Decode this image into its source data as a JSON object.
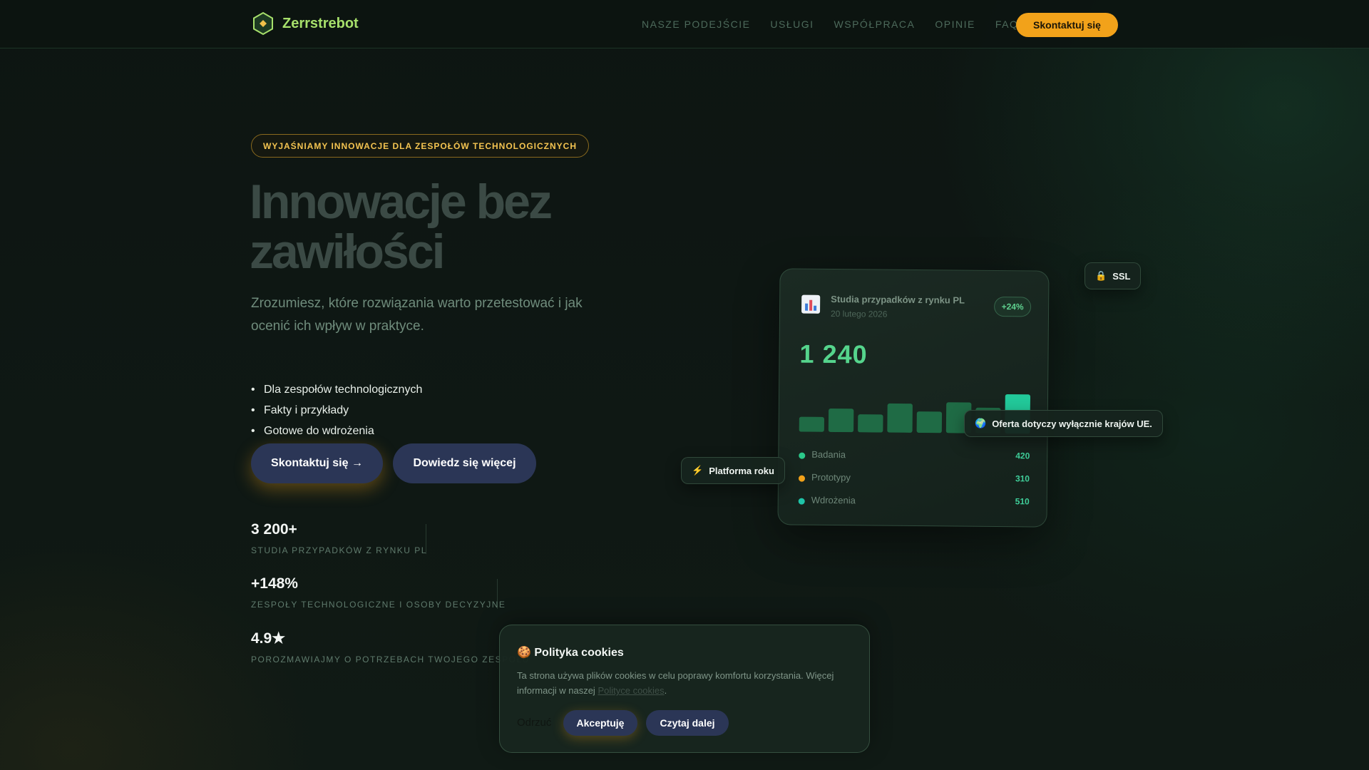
{
  "brand": {
    "name": "Zerrstrebot",
    "logo_icon": "hexagon-logo-icon",
    "accent": "#a7e06b"
  },
  "nav": {
    "items": [
      {
        "label": "NASZE PODEJŚCIE"
      },
      {
        "label": "USŁUGI"
      },
      {
        "label": "WSPÓŁPRACA"
      },
      {
        "label": "OPINIE"
      },
      {
        "label": "FAQ"
      }
    ],
    "cta_label": "Skontaktuj się",
    "cta_color": "#f2a21a"
  },
  "hero": {
    "pill": "WYJAŚNIAMY INNOWACJE DLA ZESPOŁÓW TECHNOLOGICZNYCH",
    "title": "Innowacje bez zawiłości",
    "subtitle": "Zrozumiesz, które rozwiązania warto przetestować i jak ocenić ich wpływ w praktyce.",
    "bullets": [
      "Dla zespołów technologicznych",
      "Fakty i przykłady",
      "Gotowe do wdrożenia"
    ],
    "primary_button": "Skontaktuj się →",
    "secondary_button": "Dowiedz się więcej"
  },
  "stats": [
    {
      "value": "3 200+",
      "label": "STUDIA PRZYPADKÓW Z RYNKU PL"
    },
    {
      "value": "+148%",
      "label": "ZESPOŁY TECHNOLOGICZNE I OSOBY DECYZYJNE"
    },
    {
      "value": "4.9★",
      "label": "POROZMAWIAJMY O POTRZEBACH TWOJEGO ZESPOŁU"
    }
  ],
  "dashboard": {
    "icon": "bar-chart-icon",
    "title": "Studia przypadków z rynku PL",
    "date": "20 lutego 2026",
    "badge": "+24%",
    "big_number": "1 240",
    "chart_data": {
      "type": "bar",
      "values": [
        0.35,
        0.55,
        0.42,
        0.68,
        0.5,
        0.72,
        0.6,
        0.92
      ],
      "highlight_index": 7,
      "bar_color": "#1f6b45",
      "highlight_color": "#22c99a"
    },
    "legend": [
      {
        "label": "Badania",
        "value": "420",
        "color": "#2bc98a"
      },
      {
        "label": "Prototypy",
        "value": "310",
        "color": "#f2a21a"
      },
      {
        "label": "Wdrożenia",
        "value": "510",
        "color": "#1fc4a8"
      }
    ]
  },
  "chips": {
    "ssl": {
      "icon": "lock-icon",
      "label": "SSL"
    },
    "eu": {
      "icon": "globe-icon",
      "label": "Oferta dotyczy wyłącznie krajów UE."
    },
    "platform": {
      "icon": "lightning-icon",
      "label": "Platforma roku"
    }
  },
  "cookie": {
    "icon": "cookie-icon",
    "title": "Polityka cookies",
    "text_before": "Ta strona używa plików cookies w celu poprawy komfortu korzystania. Więcej informacji w naszej ",
    "link": "Polityce cookies",
    "text_after": ".",
    "reject": "Odrzuć",
    "accept": "Akceptuję",
    "more": "Czytaj dalej"
  }
}
